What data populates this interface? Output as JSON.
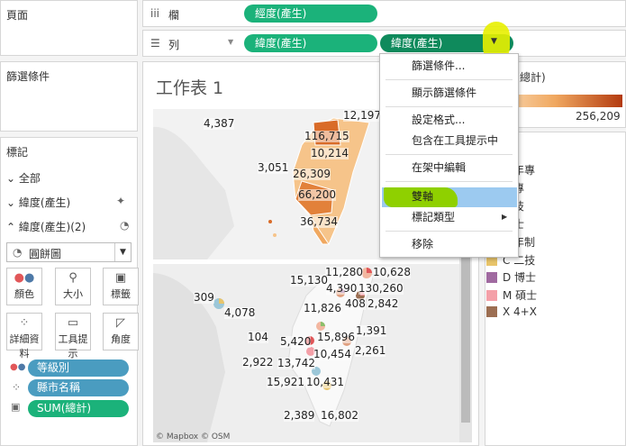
{
  "left_panel": {
    "pages_title": "頁面",
    "filters_title": "篩選條件",
    "marks_title": "標記",
    "marks_rows": [
      {
        "label": "全部"
      },
      {
        "label": "緯度(產生)"
      },
      {
        "label": "緯度(產生)(2)"
      }
    ],
    "mark_type": "圓餅圖",
    "mark_buttons": [
      {
        "label": "顏色",
        "icon": "color-dots-icon"
      },
      {
        "label": "大小",
        "icon": "size-icon"
      },
      {
        "label": "標籤",
        "icon": "label-icon"
      },
      {
        "label": "詳細資料",
        "icon": "detail-icon"
      },
      {
        "label": "工具提示",
        "icon": "tooltip-icon"
      },
      {
        "label": "角度",
        "icon": "angle-icon"
      }
    ],
    "mark_pills": [
      {
        "label": "等級別",
        "color": "#4a9cc0"
      },
      {
        "label": "縣市名稱",
        "color": "#4a9cc0"
      },
      {
        "label": "SUM(總計)",
        "color": "#1bb27a"
      }
    ]
  },
  "shelves": {
    "columns_label": "欄",
    "rows_label": "列",
    "columns_pill": "經度(產生)",
    "rows_pills": [
      "緯度(產生)",
      "緯度(產生)"
    ]
  },
  "sheet_title": "工作表 1",
  "context_menu": [
    "篩選條件...",
    "顯示篩選條件",
    "設定格式...",
    "包含在工具提示中",
    "在架中編輯",
    "雙軸",
    "標記類型",
    "移除"
  ],
  "color_legend": {
    "title_fragment": "總計)",
    "max": "256,209",
    "colors": [
      "#fce3c4",
      "#b33a0f"
    ]
  },
  "shape_legend": [
    {
      "label": "二年專",
      "color": "#f2b7a0"
    },
    {
      "label": "五專",
      "color": "#e0a080"
    },
    {
      "label": "四技",
      "color": "#9cc7d8"
    },
    {
      "label": "學士",
      "color": "#8bbf6a"
    },
    {
      "label": "二年制",
      "color": "#e8c46a"
    },
    {
      "label": "C 二技",
      "color": "#e8c46a"
    },
    {
      "label": "D 博士",
      "color": "#a06aa0"
    },
    {
      "label": "M 碩士",
      "color": "#f4a0a8"
    },
    {
      "label": "X 4+X",
      "color": "#9c6e52"
    }
  ],
  "map_top_labels": [
    "4,387",
    "12,197",
    "116,715",
    "10,214",
    "3,051",
    "26,309",
    "66,200",
    "36,734"
  ],
  "map_bottom_labels": [
    "11,280",
    "10,628",
    "15,130",
    "4,390",
    "130,260",
    "309",
    "408",
    "2,842",
    "4,078",
    "11,826",
    "1,391",
    "104",
    "5,420",
    "15,896",
    "2,922",
    "13,742",
    "10,454",
    "2,261",
    "15,921",
    "10,431",
    "2,389",
    "16,802"
  ],
  "attribution": "© Mapbox © OSM"
}
